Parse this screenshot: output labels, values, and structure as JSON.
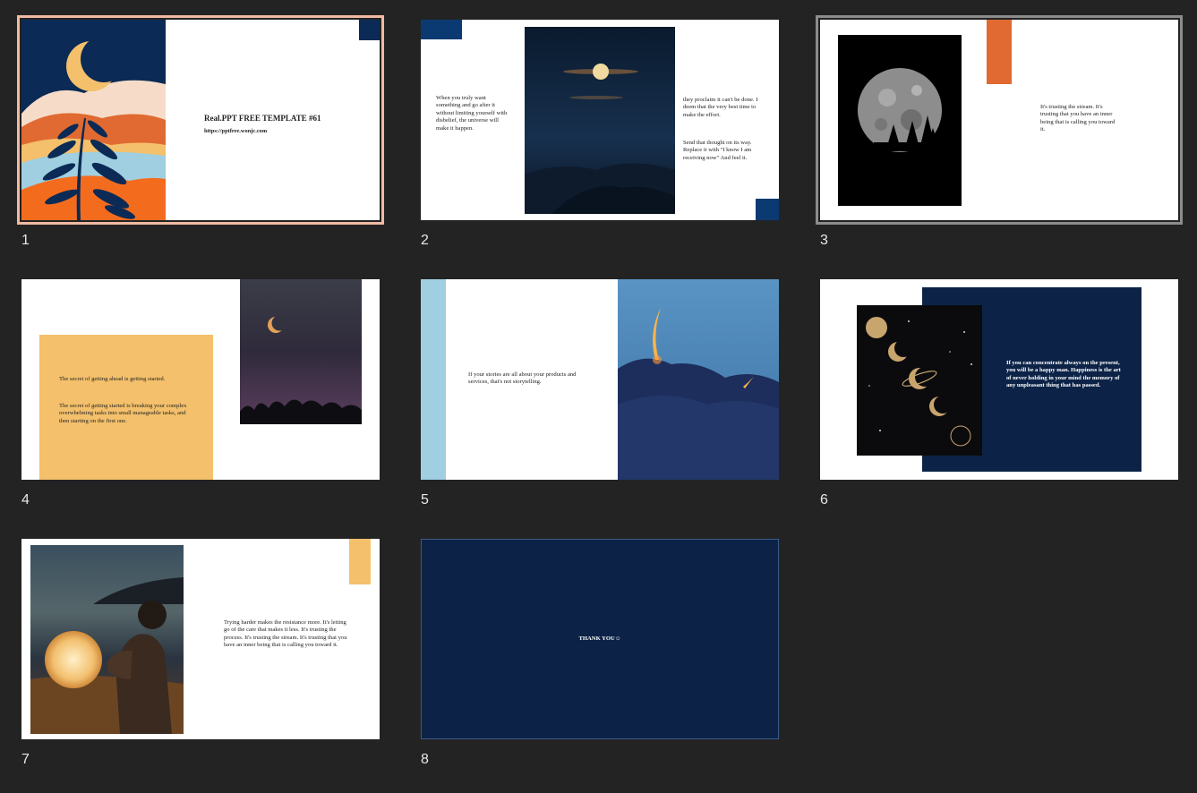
{
  "app": {
    "view": "slide-sorter"
  },
  "colors": {
    "background": "#232323",
    "navy": "#0b2a55",
    "dark_navy": "#0c2347",
    "orange": "#e06a31",
    "peach": "#f4c06b",
    "light_blue": "#9fcfe0",
    "selection_outline": "#f2b9a2",
    "hover_outline": "#8c8c8c"
  },
  "slides": [
    {
      "number": "1",
      "selected": true,
      "title": "Real.PPT FREE TEMPLATE #61",
      "url": "https://pptfree.wonjc.com",
      "image": "moon-mountain-plant-illustration"
    },
    {
      "number": "2",
      "text_left": "When you truly want something and go after it without limiting yourself with disbelief, the universe will make it happen.",
      "text_right_1": "they proclaim it can't be done. I deem that the very best time to make the effort.",
      "text_right_2": "Send that thought on its way. Replace it with \"I know I am receiving now\" And feel it.",
      "image": "moon-over-mountains-photo"
    },
    {
      "number": "3",
      "hovered": true,
      "text": "It's trusting the stream. It's trusting that you have an inner being that is calling you toward it.",
      "image": "full-moon-trees-photo"
    },
    {
      "number": "4",
      "text_1": "The secret of getting ahead is getting started.",
      "text_2": "The secret of getting started is breaking your complex overwhelming tasks into small manageable tasks, and then starting on the first one.",
      "image": "crescent-moon-dusk-photo"
    },
    {
      "number": "5",
      "text": "If your stories are all about your products and services, that's not storytelling.",
      "image": "glowing-crescents-ocean-photo"
    },
    {
      "number": "6",
      "text": "If you can concentrate always on the present, you will be a happy man. Happiness is the art of never holding in your mind the memory of any unpleasant thing that has passed.",
      "image": "moon-phases-illustration"
    },
    {
      "number": "7",
      "text": "Trying harder makes the resistance more. It's letting go of the care that makes it less. It's trusting the process. It's trusting the stream. It's trusting that you have an inner being that is calling you toward it.",
      "image": "person-with-moon-lamp-beach-photo"
    },
    {
      "number": "8",
      "text": "THANK YOU☺"
    }
  ]
}
